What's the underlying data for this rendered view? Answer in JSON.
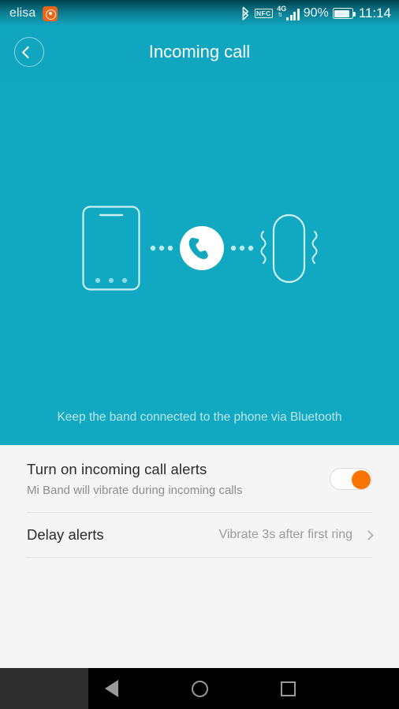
{
  "status_bar": {
    "carrier": "elisa",
    "app_badge_icon": "orange-app-badge-icon",
    "bluetooth_icon": "bluetooth-icon",
    "nfc_label": "NFC",
    "network_type": "4G",
    "signal_icon": "signal-bars-icon",
    "battery_percent": "90%",
    "battery_icon": "battery-icon",
    "clock": "11:14"
  },
  "appbar": {
    "back_icon": "chevron-left-icon",
    "title": "Incoming call"
  },
  "hero": {
    "phone_icon": "smartphone-outline-icon",
    "dots_left_icon": "transmission-dots-icon",
    "call_icon": "phone-handset-icon",
    "dots_right_icon": "transmission-dots-icon",
    "band_icon": "fitness-band-outline-icon",
    "vibration_icon": "vibration-waves-icon",
    "hint": "Keep the band connected to the phone via Bluetooth"
  },
  "settings": {
    "alerts_row": {
      "title": "Turn on incoming call alerts",
      "subtitle": "Mi Band will vibrate during incoming calls",
      "toggle_state": "on",
      "toggle_accent": "#f97305"
    },
    "delay_row": {
      "title": "Delay alerts",
      "value": "Vibrate 3s after first ring",
      "chevron_icon": "chevron-right-icon"
    }
  },
  "nav_bar": {
    "back_icon": "triangle-back-icon",
    "home_icon": "circle-home-icon",
    "recents_icon": "square-recents-icon"
  },
  "colors": {
    "teal": "#11a8c2",
    "appbar_teal": "#10a6c0",
    "panel_bg": "#f5f5f5",
    "accent_orange": "#f97305",
    "nav_bg": "#000000"
  }
}
